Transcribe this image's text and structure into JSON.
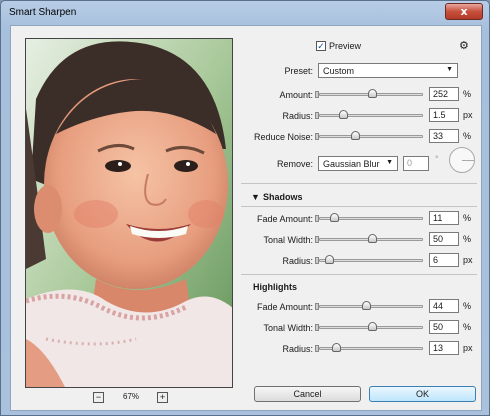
{
  "window": {
    "title": "Smart Sharpen",
    "close_label": "x"
  },
  "preview": {
    "label": "Preview",
    "checked": true,
    "check_mark": "✓"
  },
  "gear_glyph": "⚙",
  "preset": {
    "label": "Preset:",
    "value": "Custom"
  },
  "main": {
    "amount": {
      "label": "Amount:",
      "value": "252",
      "unit": "%",
      "level": 0.5
    },
    "radius": {
      "label": "Radius:",
      "value": "1.5",
      "unit": "px",
      "level": 0.2
    },
    "reduce_noise": {
      "label": "Reduce Noise:",
      "value": "33",
      "unit": "%",
      "level": 0.33
    }
  },
  "remove": {
    "label": "Remove:",
    "value": "Gaussian Blur",
    "angle": "0",
    "angle_unit": "°"
  },
  "shadows": {
    "title": "Shadows",
    "collapse_glyph": "▼",
    "fade_amount": {
      "label": "Fade Amount:",
      "value": "11",
      "unit": "%",
      "level": 0.11
    },
    "tonal_width": {
      "label": "Tonal Width:",
      "value": "50",
      "unit": "%",
      "level": 0.5
    },
    "radius": {
      "label": "Radius:",
      "value": "6",
      "unit": "px",
      "level": 0.06
    }
  },
  "highlights": {
    "title": "Highlights",
    "fade_amount": {
      "label": "Fade Amount:",
      "value": "44",
      "unit": "%",
      "level": 0.44
    },
    "tonal_width": {
      "label": "Tonal Width:",
      "value": "50",
      "unit": "%",
      "level": 0.5
    },
    "radius": {
      "label": "Radius:",
      "value": "13",
      "unit": "px",
      "level": 0.13
    }
  },
  "zoom": {
    "minus": "−",
    "value": "67%",
    "plus": "+"
  },
  "buttons": {
    "cancel": "Cancel",
    "ok": "OK"
  }
}
